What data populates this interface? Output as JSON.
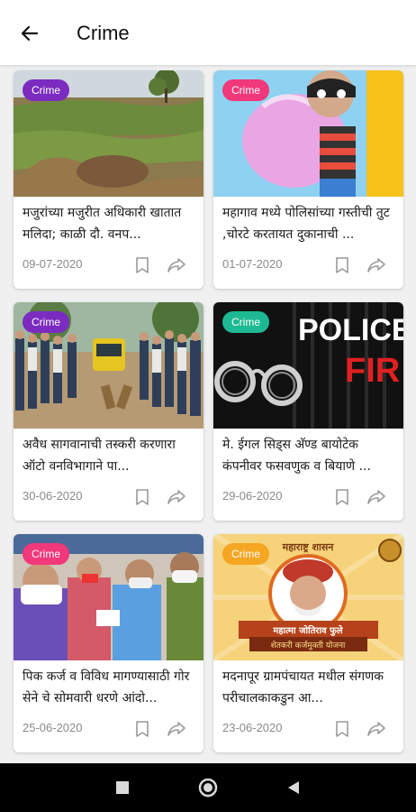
{
  "header": {
    "title": "Crime",
    "back_icon": "arrow-left-icon"
  },
  "colors": {
    "purple": "#7b2bbf",
    "pink": "#f0387a",
    "teal": "#1db992",
    "orange": "#f5a623"
  },
  "cards": [
    {
      "badge": "Crime",
      "badge_color": "#7b2bbf",
      "headline": "मजुरांच्या मजुरीत अधिकारी खातात मलिदा; काळी दौ. वनप...",
      "date": "09-07-2020"
    },
    {
      "badge": "Crime",
      "badge_color": "#f0387a",
      "headline": "महागाव मध्ये पोलिसांच्या गस्तीची तुट ,चोरटे करतायत दुकानाची ...",
      "date": "01-07-2020"
    },
    {
      "badge": "Crime",
      "badge_color": "#7b2bbf",
      "headline": "अवैध सागवानाची तस्करी करणारा ऑटो वनविभागाने पा...",
      "date": "30-06-2020"
    },
    {
      "badge": "Crime",
      "badge_color": "#1db992",
      "headline": "मे. ईगल सिड्स अ‍ॅण्ड बायोटेक कंपनीवर फसवणुक व बियाणे ...",
      "date": "29-06-2020"
    },
    {
      "badge": "Crime",
      "badge_color": "#f0387a",
      "headline": "पिक कर्ज व विविध मागण्यासाठी गोर सेने चे सोमवारी धरणे आंदो...",
      "date": "25-06-2020"
    },
    {
      "badge": "Crime",
      "badge_color": "#f5a623",
      "headline": "मदनापूर ग्रामपंचायत मधील संगणक परीचालकाकडुन आ...",
      "date": "23-06-2020"
    }
  ],
  "images": {
    "police_text": "POLICE",
    "fir_text": "FIR",
    "poster_top": "महाराष्ट्र शासन",
    "poster_banner_1": "महात्मा जोतिराव फुले",
    "poster_banner_2": "शेतकरी कर्जमुक्ती योजना"
  },
  "navbar": {
    "recent_icon": "square-icon",
    "home_icon": "circle-home-icon",
    "back_icon": "triangle-back-icon"
  }
}
